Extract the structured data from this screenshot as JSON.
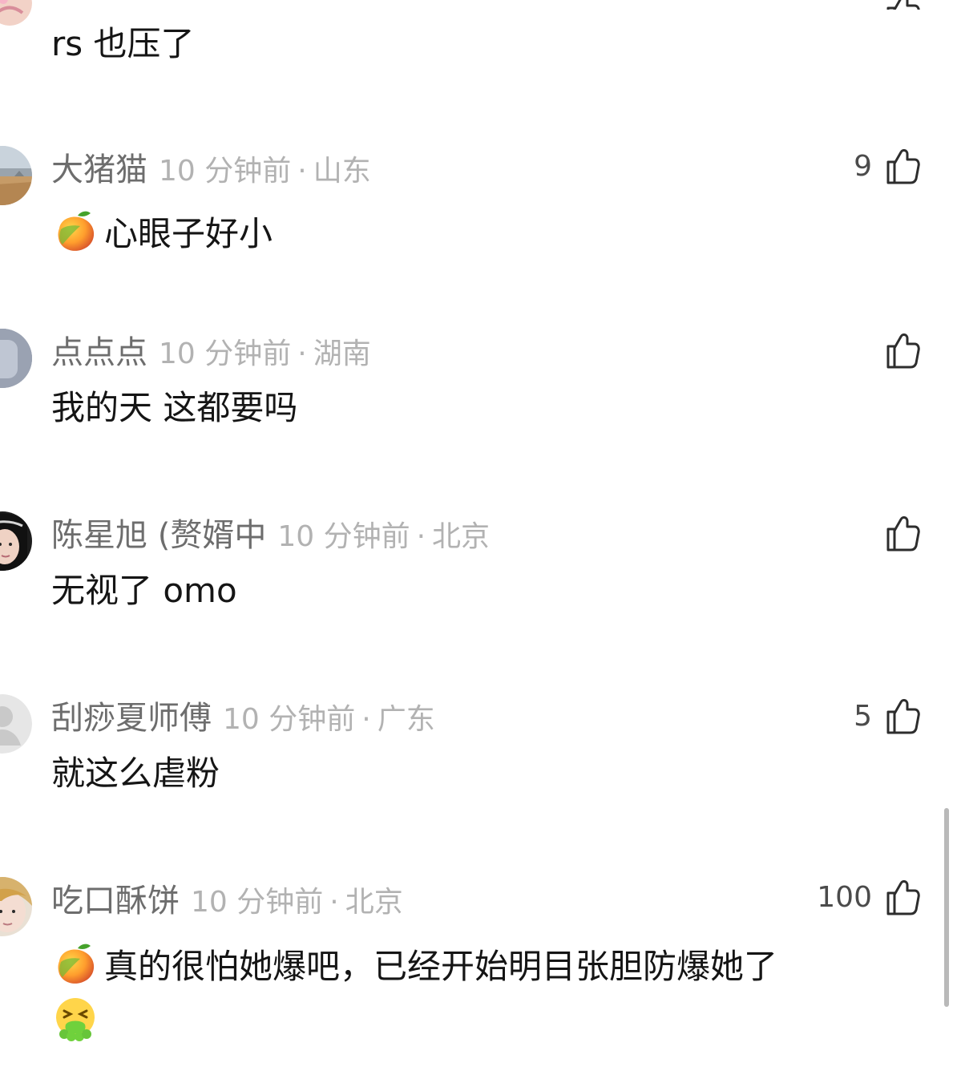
{
  "colors": {
    "author": "#6d6d6d",
    "meta": "#b2b2b2",
    "text": "#151515",
    "like": "#4b4b4b"
  },
  "top_comment": {
    "text": "rs 也压了"
  },
  "comments": [
    {
      "author": "大猪猫",
      "time": "10 分钟前",
      "location": "山东",
      "likes": "9",
      "emoji": "mango",
      "text": "心眼子好小"
    },
    {
      "author": "点点点",
      "time": "10 分钟前",
      "location": "湖南",
      "likes": "",
      "text": "我的天 这都要吗"
    },
    {
      "author": "陈星旭 (赘婿中",
      "time": "10 分钟前",
      "location": "北京",
      "likes": "",
      "text": "无视了 omo"
    },
    {
      "author": "刮痧夏师傅",
      "time": "10 分钟前",
      "location": "广东",
      "likes": "5",
      "text": "就这么虐粉"
    },
    {
      "author": "吃口酥饼",
      "time": "10 分钟前",
      "location": "北京",
      "likes": "100",
      "emoji": "mango",
      "text": "真的很怕她爆吧，已经开始明目张胆防爆她了"
    }
  ],
  "icons": {
    "like": "thumbs-up-icon",
    "mango": "mango-emoji-icon",
    "vomit": "vomiting-face-emoji-icon"
  },
  "separator": "·"
}
